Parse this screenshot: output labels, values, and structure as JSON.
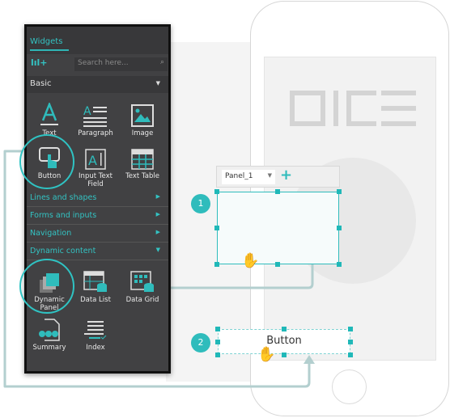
{
  "panel": {
    "tab": "Widgets",
    "search_placeholder": "Search here...",
    "basic": "Basic",
    "basic_widgets": [
      "Text",
      "Paragraph",
      "Image",
      "Button",
      "Input Text Field",
      "Text Table"
    ],
    "categories": [
      "Lines and shapes",
      "Forms and inputs",
      "Navigation",
      "Dynamic content"
    ],
    "dynamic_widgets": [
      "Dynamic Panel",
      "Data List",
      "Data Grid",
      "Summary",
      "Index"
    ]
  },
  "canvas": {
    "panel_select": "Panel_1",
    "add": "+",
    "badge1": "1",
    "badge2": "2",
    "button_label": "Button",
    "logo": "DICE"
  },
  "colors": {
    "accent": "#2fbcbc",
    "panel_bg": "#414143",
    "connector": "#b3cfcf"
  }
}
